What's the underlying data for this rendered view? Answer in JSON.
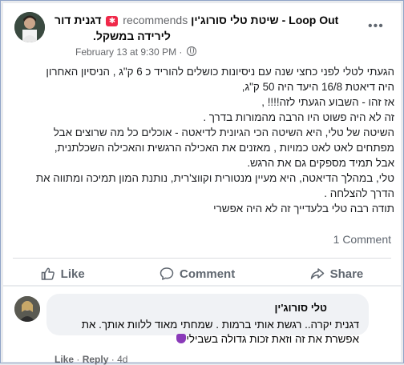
{
  "post": {
    "author": "דגנית דור",
    "recommends": "recommends",
    "page_name": "שיטת טלי סורוג'ין - Loop Out",
    "page_name_line2": "לירידה במשקל.",
    "date": "February 13 at 9:30 PM",
    "separator": "·",
    "more_label": "•••",
    "body_lines": [
      "הגעתי לטלי לפני כחצי שנה עם ניסיונות כושלים להוריד כ 6 ק\"ג , הניסיון האחרון",
      "היה דיאטת 16/8 היעד היה 50 ק\"ג,",
      "אז זהו - השבוע הגעתי לזה!!!! ,",
      "זה לא היה  פשוט היו הרבה מהמורות בדרך .",
      "השיטה של טלי, היא השיטה הכי הגיונית לדיאטה - אוכלים כל מה שרוצים אבל",
      "מפתחים לאט לאט כמויות , מאזנים את האכילה הרגשית והאכילה השכלתנית,",
      "אבל תמיד מספקים גם את הרגש.",
      "טלי, במהלך הדיאטה, היא מעיין מנטורית וקווצ'רית, נותנת המון תמיכה ומתווה את",
      "הדרך להצלחה .",
      "תודה רבה טלי בלעדייך זה לא היה אפשרי"
    ],
    "comments_count": "1 Comment"
  },
  "actions": {
    "like": "Like",
    "comment": "Comment",
    "share": "Share"
  },
  "comment": {
    "author": "טלי סורוג'ין",
    "lines": [
      "דגנית יקרה.. רגשת אותי ברמות . שמחתי מאוד ללוות אותך. את",
      "אפשרת את זה וזאת זכות גדולה בשבילי"
    ],
    "like_label": "Like",
    "reply_label": "Reply",
    "time": "4d"
  },
  "colors": {
    "accent": "#1877f2",
    "badge": "#f02849",
    "secondary_text": "#65676b"
  }
}
